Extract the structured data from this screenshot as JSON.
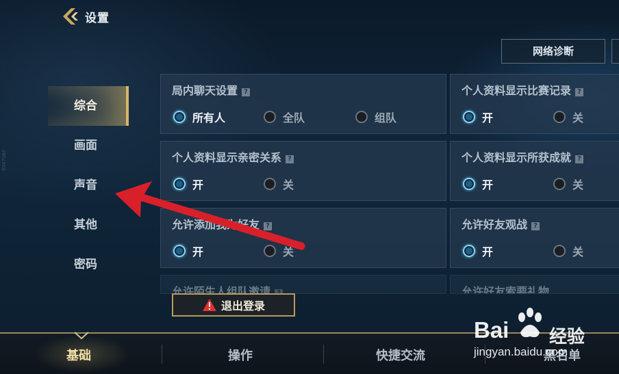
{
  "header": {
    "title": "设置",
    "diagnose_label": "网络诊断"
  },
  "sidebar": {
    "items": [
      {
        "label": "综合",
        "active": true
      },
      {
        "label": "画面",
        "active": false
      },
      {
        "label": "声音",
        "active": false
      },
      {
        "label": "其他",
        "active": false
      },
      {
        "label": "密码",
        "active": false
      }
    ]
  },
  "settings": {
    "chat": {
      "title": "局内聊天设置",
      "options": [
        "所有人",
        "全队",
        "组队"
      ],
      "selected": "所有人"
    },
    "match_record": {
      "title": "个人资料显示比赛记录",
      "options": [
        "开",
        "关"
      ],
      "selected": "开"
    },
    "intimacy": {
      "title": "个人资料显示亲密关系",
      "options": [
        "开",
        "关"
      ],
      "selected": "开"
    },
    "achievements": {
      "title": "个人资料显示所获成就",
      "options": [
        "开",
        "关"
      ],
      "selected": "开"
    },
    "add_friend": {
      "title": "允许添加我为好友",
      "options": [
        "开",
        "关"
      ],
      "selected": "开"
    },
    "spectate": {
      "title": "允许好友观战",
      "options": [
        "开",
        "关"
      ],
      "selected": "开"
    },
    "stranger_invite": {
      "title": "允许陌生人组队邀请"
    },
    "gift_request": {
      "title": "允许好友索要礼物"
    }
  },
  "help_glyph": "?",
  "logout_label": "退出登录",
  "bottom_tabs": [
    {
      "label": "基础",
      "active": true
    },
    {
      "label": "操作",
      "active": false
    },
    {
      "label": "快捷交流",
      "active": false
    },
    {
      "label": "黑名单",
      "active": false
    }
  ],
  "watermark": {
    "logo": "Bai",
    "logo_tail": "经验",
    "url": "jingyan.baidu.com"
  },
  "side_code": "8047086",
  "colors": {
    "accent_gold": "#d6b66a",
    "radio_on": "#8fd6f2",
    "arrow_red": "#d9202a",
    "warning_red": "#e0332f"
  }
}
